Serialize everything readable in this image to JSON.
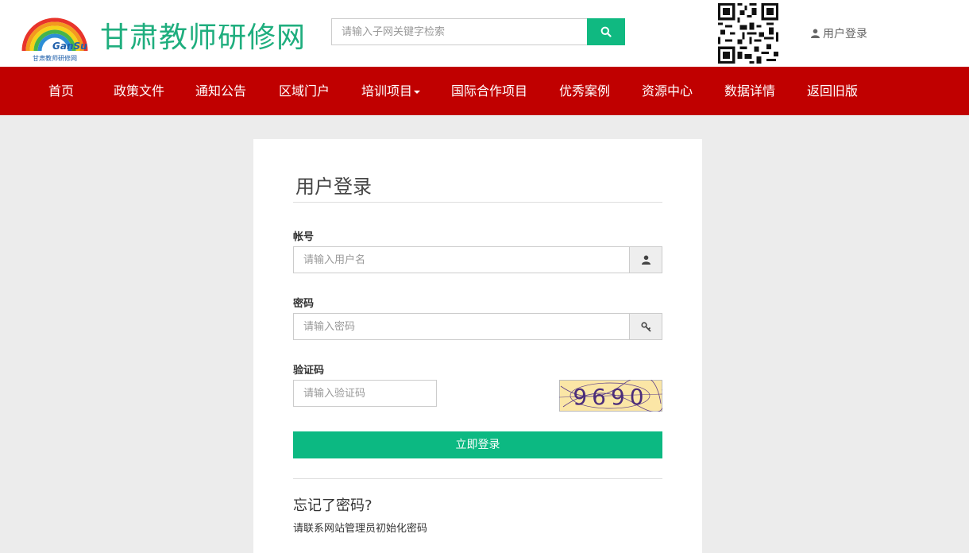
{
  "header": {
    "site_title": "甘肃教师研修网",
    "logo_text": "GanSu",
    "logo_subtext": "甘肃教师研修网",
    "search_placeholder": "请输入子网关键字检索",
    "login_link": "用户登录"
  },
  "nav": {
    "items": [
      {
        "label": "首页"
      },
      {
        "label": "政策文件"
      },
      {
        "label": "通知公告"
      },
      {
        "label": "区域门户"
      },
      {
        "label": "培训项目",
        "has_dropdown": true
      },
      {
        "label": "国际合作项目"
      },
      {
        "label": "优秀案例"
      },
      {
        "label": "资源中心"
      },
      {
        "label": "数据详情"
      },
      {
        "label": "返回旧版"
      }
    ]
  },
  "login_form": {
    "title": "用户登录",
    "account_label": "帐号",
    "account_placeholder": "请输入用户名",
    "password_label": "密码",
    "password_placeholder": "请输入密码",
    "captcha_label": "验证码",
    "captcha_placeholder": "请输入验证码",
    "captcha_value": "9690",
    "submit_label": "立即登录",
    "forgot_title": "忘记了密码?",
    "forgot_text": "请联系网站管理员初始化密码"
  },
  "colors": {
    "brand_green": "#1fae7e",
    "nav_red": "#c00000",
    "button_green": "#0cb982",
    "background": "#ececec"
  },
  "icons": {
    "search": "search-icon",
    "user": "user-icon",
    "key": "key-icon",
    "qr": "qr-code"
  }
}
